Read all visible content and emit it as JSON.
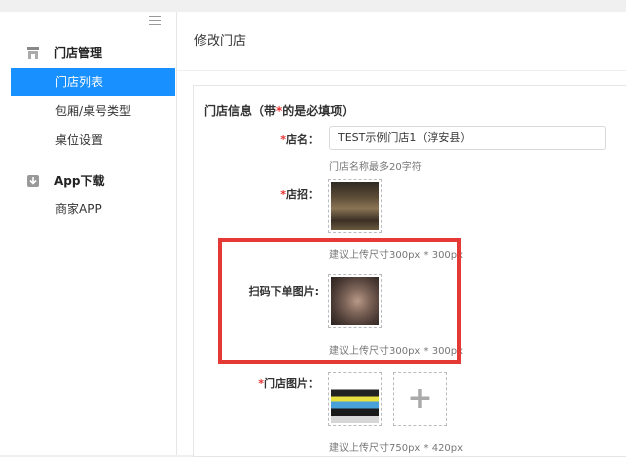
{
  "sidebar": {
    "sections": [
      {
        "label": "门店管理",
        "icon": "store-icon"
      },
      {
        "label": "App下载",
        "icon": "download-icon"
      }
    ],
    "items": [
      {
        "label": "门店列表",
        "active": true
      },
      {
        "label": "包厢/桌号类型",
        "active": false
      },
      {
        "label": "桌位设置",
        "active": false
      },
      {
        "label": "商家APP",
        "active": false
      }
    ]
  },
  "main": {
    "title": "修改门店",
    "panel": {
      "heading_pre": "门店信息（带",
      "heading_star": "*",
      "heading_post": "的是必填项）",
      "fields": {
        "name": {
          "label": "店名：",
          "value": "TEST示例门店1（淳安县）",
          "hint": "门店名称最多20字符"
        },
        "sign": {
          "label": "店招：",
          "hint": "建议上传尺寸300px * 300px"
        },
        "qr": {
          "label": "扫码下单图片:",
          "hint": "建议上传尺寸300px * 300px"
        },
        "photos": {
          "label": "门店图片：",
          "hint": "建议上传尺寸750px * 420px"
        }
      },
      "required_mark": "*"
    }
  },
  "colors": {
    "accent": "#1890ff",
    "required": "#e63030",
    "highlight": "#e53935"
  }
}
